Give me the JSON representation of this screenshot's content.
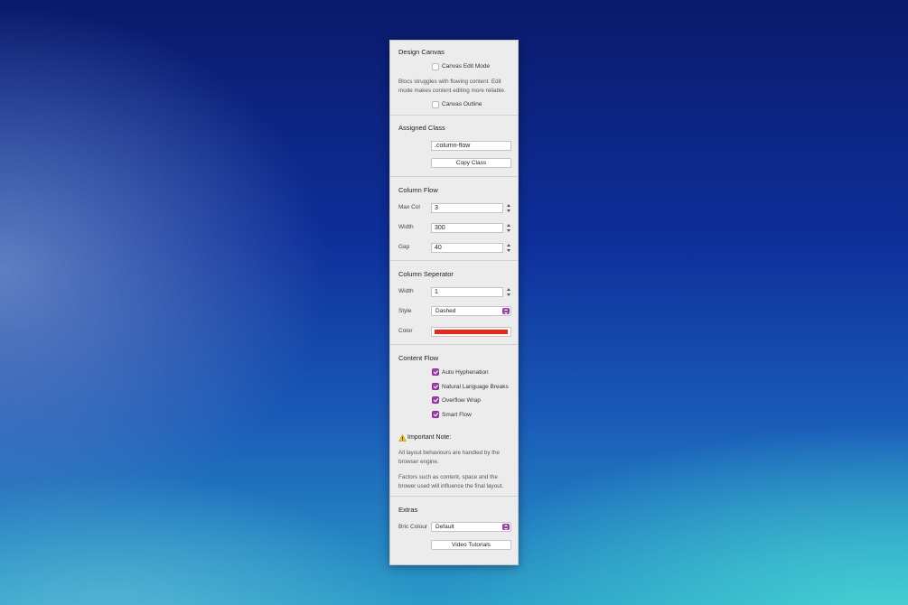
{
  "design_canvas": {
    "title": "Design Canvas",
    "edit_mode_label": "Canvas Edit Mode",
    "edit_mode_checked": false,
    "description": "Blocs struggles with flowing content. Edit mode makes content editing more reliable.",
    "outline_label": "Canvas Outline",
    "outline_checked": false
  },
  "assigned_class": {
    "title": "Assigned Class",
    "value": ".column-flow",
    "copy_button": "Copy Class"
  },
  "column_flow": {
    "title": "Column Flow",
    "max_col_label": "Max Col",
    "max_col_value": "3",
    "width_label": "Width",
    "width_value": "300",
    "gap_label": "Gap",
    "gap_value": "40"
  },
  "column_separator": {
    "title": "Column Seperator",
    "width_label": "Width",
    "width_value": "1",
    "style_label": "Style",
    "style_value": "Dashed",
    "color_label": "Color",
    "color_value": "#f2260f"
  },
  "content_flow": {
    "title": "Content Flow",
    "options": [
      {
        "label": "Auto Hyphenation",
        "checked": true
      },
      {
        "label": "Natural Language Breaks",
        "checked": true
      },
      {
        "label": "Overflow Wrap",
        "checked": true
      },
      {
        "label": "Smart Flow",
        "checked": true
      }
    ],
    "note_icon": "warning-icon",
    "note_title": "Important Note:",
    "note_text_1": "All layout behaviours are handled by the browser engine.",
    "note_text_2": "Factors such as content, space and the brower used will influence the final layout."
  },
  "extras": {
    "title": "Extras",
    "bric_colour_label": "Bric Colour",
    "bric_colour_value": "Default",
    "tutorials_button": "Video Tutorials"
  },
  "accent_color": "#a43bb0"
}
